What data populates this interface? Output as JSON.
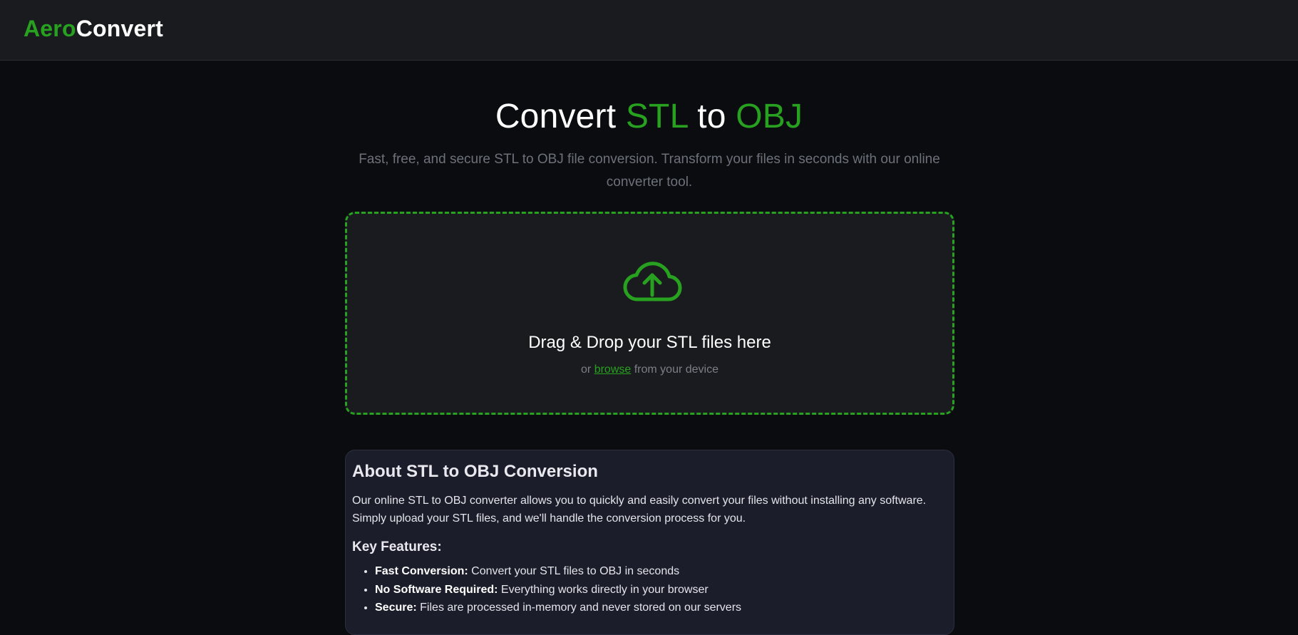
{
  "header": {
    "logo_part1": "Aero",
    "logo_part2": "Convert"
  },
  "hero": {
    "title_word1": "Convert",
    "title_format_from": "STL",
    "title_word2": "to",
    "title_format_to": "OBJ",
    "subtitle": "Fast, free, and secure STL to OBJ file conversion. Transform your files in seconds with our online converter tool."
  },
  "dropzone": {
    "icon": "cloud-upload-icon",
    "title": "Drag & Drop your STL files here",
    "sub_prefix": "or",
    "browse_link": "browse",
    "sub_suffix": "from your device"
  },
  "about": {
    "heading": "About STL to OBJ Conversion",
    "body": "Our online STL to OBJ converter allows you to quickly and easily convert your files without installing any software. Simply upload your STL files, and we'll handle the conversion process for you.",
    "features_heading": "Key Features:",
    "features": [
      {
        "label": "Fast Conversion:",
        "text": "Convert your STL files to OBJ in seconds"
      },
      {
        "label": "No Software Required:",
        "text": "Everything works directly in your browser"
      },
      {
        "label": "Secure:",
        "text": "Files are processed in-memory and never stored on our servers"
      }
    ]
  },
  "colors": {
    "accent": "#27a11f",
    "background": "#0a0c10",
    "panel": "#1a1b1e",
    "card": "#1b1d2a"
  }
}
